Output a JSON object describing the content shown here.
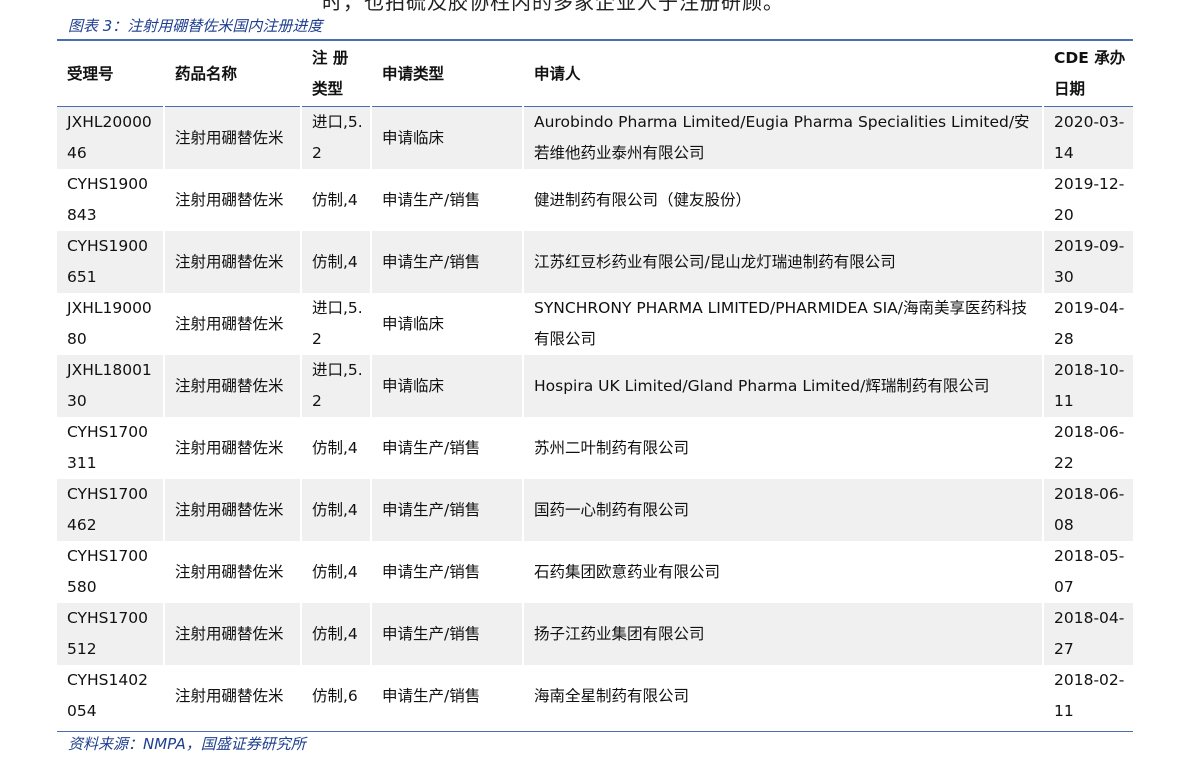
{
  "header_fragment": "时，也拍硫及胶协柱内的多家企业人于注册研顾。",
  "caption": "图表 3：注射用硼替佐米国内注册进度",
  "columns": [
    "受理号",
    "药品名称",
    "注 册 类型",
    "申请类型",
    "申请人",
    "CDE 承办日期"
  ],
  "rows": [
    {
      "id": "JXHL2000046",
      "drug": "注射用硼替佐米",
      "reg_type": "进口,5.2",
      "app_type": "申请临床",
      "applicant": "Aurobindo Pharma Limited/Eugia Pharma Specialities Limited/安若维他药业泰州有限公司",
      "date": "2020-03-14"
    },
    {
      "id": "CYHS1900843",
      "drug": "注射用硼替佐米",
      "reg_type": "仿制,4",
      "app_type": "申请生产/销售",
      "applicant": "健进制药有限公司（健友股份）",
      "date": "2019-12-20"
    },
    {
      "id": "CYHS1900651",
      "drug": "注射用硼替佐米",
      "reg_type": "仿制,4",
      "app_type": "申请生产/销售",
      "applicant": "江苏红豆杉药业有限公司/昆山龙灯瑞迪制药有限公司",
      "date": "2019-09-30"
    },
    {
      "id": "JXHL1900080",
      "drug": "注射用硼替佐米",
      "reg_type": "进口,5.2",
      "app_type": "申请临床",
      "applicant": "SYNCHRONY PHARMA LIMITED/PHARMIDEA SIA/海南美享医药科技有限公司",
      "date": "2019-04-28"
    },
    {
      "id": "JXHL1800130",
      "drug": "注射用硼替佐米",
      "reg_type": "进口,5.2",
      "app_type": "申请临床",
      "applicant": "Hospira UK Limited/Gland Pharma Limited/辉瑞制药有限公司",
      "date": "2018-10-11"
    },
    {
      "id": "CYHS1700311",
      "drug": "注射用硼替佐米",
      "reg_type": "仿制,4",
      "app_type": "申请生产/销售",
      "applicant": "苏州二叶制药有限公司",
      "date": "2018-06-22"
    },
    {
      "id": "CYHS1700462",
      "drug": "注射用硼替佐米",
      "reg_type": "仿制,4",
      "app_type": "申请生产/销售",
      "applicant": "国药一心制药有限公司",
      "date": "2018-06-08"
    },
    {
      "id": "CYHS1700580",
      "drug": "注射用硼替佐米",
      "reg_type": "仿制,4",
      "app_type": "申请生产/销售",
      "applicant": "石药集团欧意药业有限公司",
      "date": "2018-05-07"
    },
    {
      "id": "CYHS1700512",
      "drug": "注射用硼替佐米",
      "reg_type": "仿制,4",
      "app_type": "申请生产/销售",
      "applicant": "扬子江药业集团有限公司",
      "date": "2018-04-27"
    },
    {
      "id": "CYHS1402054",
      "drug": "注射用硼替佐米",
      "reg_type": "仿制,6",
      "app_type": "申请生产/销售",
      "applicant": "海南全星制药有限公司",
      "date": "2018-02-11"
    }
  ],
  "source": "资料来源：NMPA，国盛证券研究所"
}
